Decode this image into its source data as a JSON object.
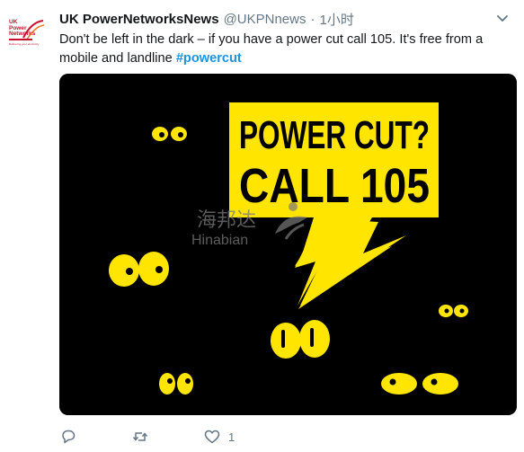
{
  "tweet": {
    "display_name": "UK PowerNetworksNews",
    "handle": "@UKPNnews",
    "separator": "·",
    "timestamp": "1小时",
    "text_main": "Don't be left in the dark – if you have a power cut call 105. It's free from a mobile and landline ",
    "hashtag": "#powercut"
  },
  "avatar": {
    "line1": "UK",
    "line2": "Power",
    "line3": "Networks",
    "tagline": "Delivering your electricity"
  },
  "media": {
    "headline_line1": "POWER CUT?",
    "headline_line2": "CALL 105",
    "watermark_cn": "海邦达",
    "watermark_en": "Hinabian",
    "background_color": "#000000",
    "accent_color": "#ffe500"
  },
  "actions": {
    "reply_count": "",
    "retweet_count": "",
    "like_count": "1"
  },
  "icons": {
    "caret": "chevron-down-icon",
    "reply": "reply-icon",
    "retweet": "retweet-icon",
    "like": "heart-icon"
  },
  "colors": {
    "text": "#14171a",
    "secondary": "#657786",
    "link": "#1b95e0",
    "brand_red": "#c8102e"
  }
}
